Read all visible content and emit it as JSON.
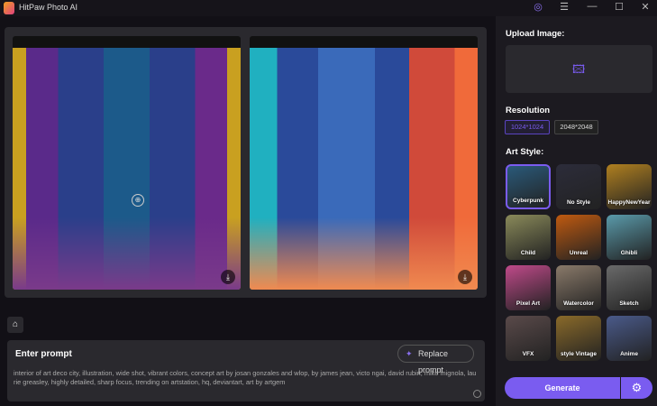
{
  "app": {
    "title": "HitPaw Photo AI"
  },
  "window_controls": {
    "account": "◎",
    "menu": "☰",
    "minimize": "—",
    "maximize": "☐",
    "close": "✕"
  },
  "preview": {
    "zoom_icon": "⊕",
    "download_icon": "⤓"
  },
  "prompt": {
    "label": "Enter prompt",
    "replace_label": "Replace prompt",
    "replace_icon": "✦",
    "text": "interior of art deco city, illustration, wide shot, vibrant colors, concept art by josan gonzales and wlop, by james jean, victo ngai, david rubin, mike mignola, laurie greasley, highly detailed, sharp focus, trending on artstation, hq, deviantart, art by artgem"
  },
  "home_icon": "⌂",
  "sidebar": {
    "upload_label": "Upload Image:",
    "upload_icon": "🖾",
    "resolution_label": "Resolution",
    "resolutions": [
      {
        "label": "1024*1024",
        "selected": true
      },
      {
        "label": "2048*2048",
        "selected": false
      }
    ],
    "art_style_label": "Art Style:",
    "styles": [
      {
        "label": "Cyberpunk",
        "selected": true,
        "color": "#2a5a7a"
      },
      {
        "label": "No Style",
        "color": "#2c2c3a"
      },
      {
        "label": "HappyNewYear",
        "color": "#b08020"
      },
      {
        "label": "Child",
        "color": "#8a8a5a"
      },
      {
        "label": "Unreal",
        "color": "#c05a10"
      },
      {
        "label": "Ghibli",
        "color": "#5a9aaa"
      },
      {
        "label": "Pixel Art",
        "color": "#c04a8a"
      },
      {
        "label": "Watercolor",
        "color": "#8a7a6a"
      },
      {
        "label": "Sketch",
        "color": "#6a6a6a"
      },
      {
        "label": "VFX",
        "color": "#5a4a4a"
      },
      {
        "label": "style Vintage",
        "color": "#8a6a2a"
      },
      {
        "label": "Anime",
        "color": "#4a5a8a"
      }
    ],
    "generate_label": "Generate",
    "settings_icon": "⚙"
  },
  "colors": {
    "accent": "#7a5cf0"
  }
}
